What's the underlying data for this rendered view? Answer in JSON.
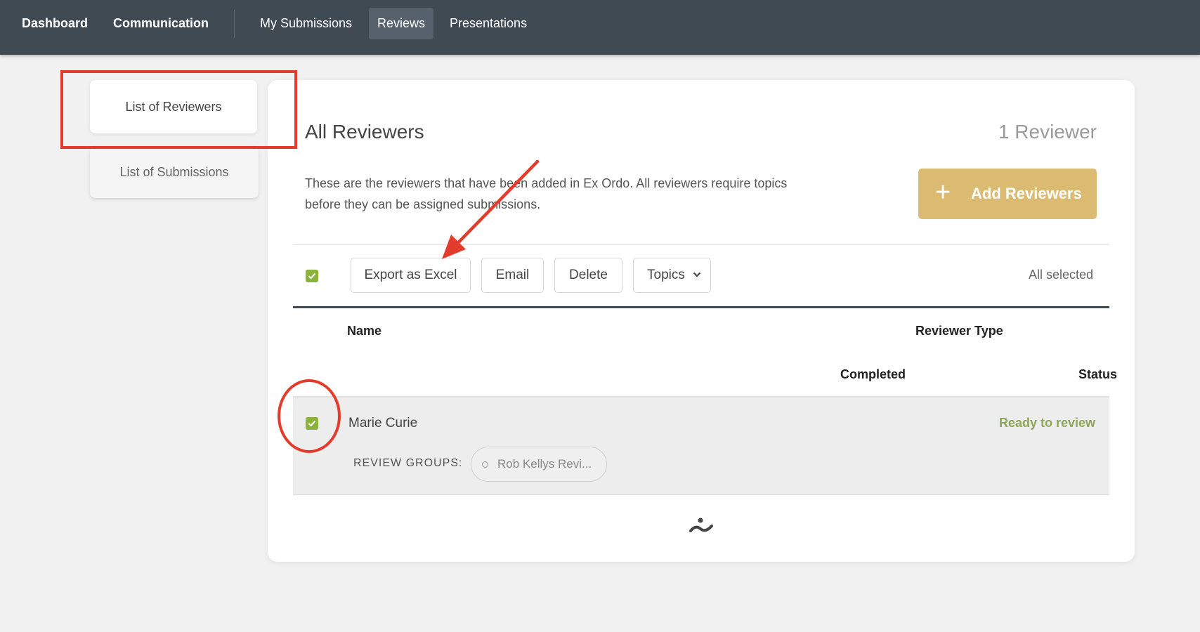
{
  "nav": {
    "items": [
      "Dashboard",
      "Communication",
      "My Submissions",
      "Reviews",
      "Presentations"
    ]
  },
  "sidebar": {
    "tabs": [
      "List of Reviewers",
      "List of Submissions"
    ]
  },
  "main": {
    "title": "All Reviewers",
    "count": "1 Reviewer",
    "description": "These are the reviewers that have been added in Ex Ordo. All reviewers require topics before they can be assigned submissions.",
    "add_button": "Add Reviewers"
  },
  "toolbar": {
    "buttons": [
      "Export as Excel",
      "Email",
      "Delete",
      "Topics"
    ],
    "selection_status": "All selected"
  },
  "table": {
    "headers": {
      "name": "Name",
      "reviewer_type": "Reviewer Type",
      "completed": "Completed",
      "status": "Status"
    },
    "rows": [
      {
        "name": "Marie Curie",
        "status": "Ready to review",
        "review_groups_label": "REVIEW GROUPS:",
        "review_group": "Rob Kellys Revi..."
      }
    ]
  },
  "colors": {
    "topbar": "#404a53",
    "accent_gold": "#dbbb72",
    "checkbox_green": "#8bb33a",
    "status_green": "#8fa65a",
    "annotation_red": "#e43c2c"
  },
  "icons": {
    "checkbox": "check-icon",
    "add": "plus-icon",
    "dropdown": "chevron-down-icon",
    "group": "circle-icon",
    "loader": "loader-icon"
  }
}
